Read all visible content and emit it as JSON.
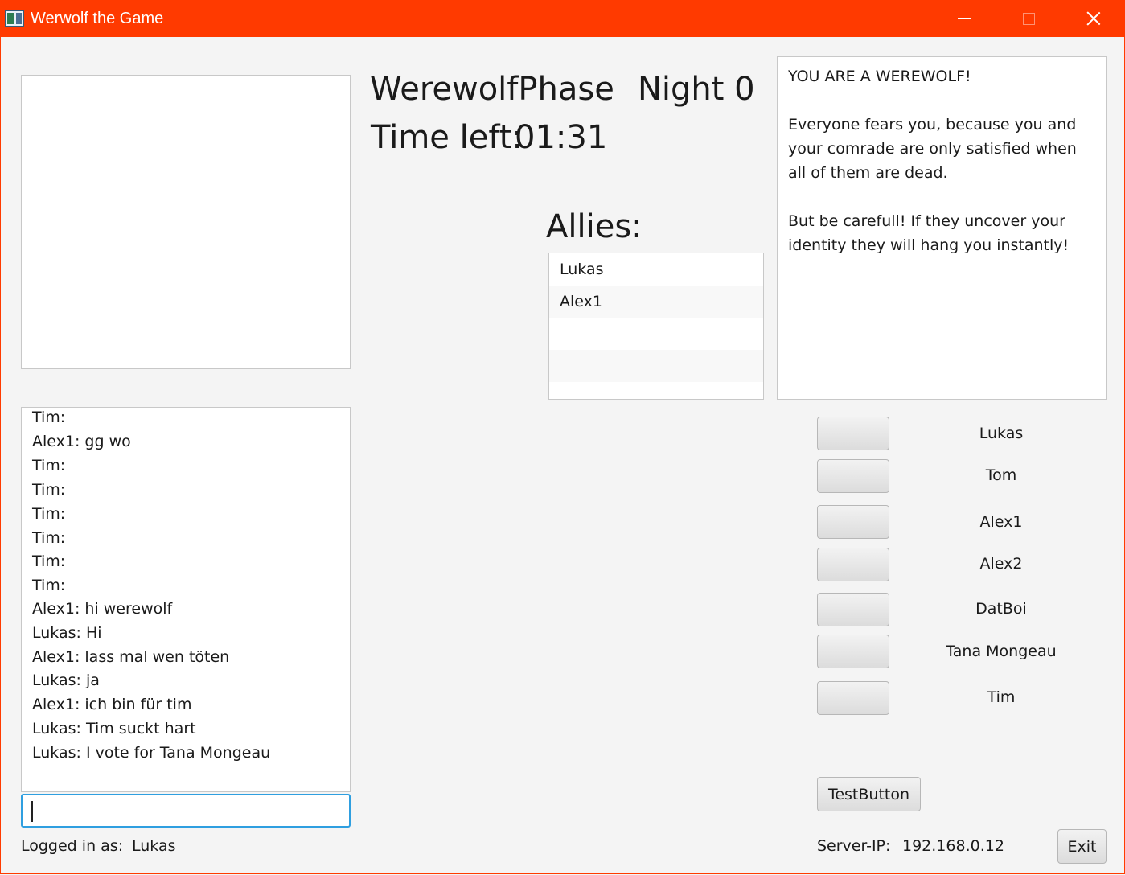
{
  "window": {
    "title": "Werwolf the Game"
  },
  "phase": {
    "name": "WerewolfPhase",
    "night": "Night 0",
    "time_label": "Time left:",
    "time_value": "01:31"
  },
  "allies": {
    "label": "Allies:",
    "items": [
      "Lukas",
      "Alex1"
    ]
  },
  "role": {
    "paragraphs": [
      "YOU ARE A WEREWOLF!",
      "Everyone fears you, because you and your comrade are only satisfied when all of them are dead.",
      "But be carefull! If they uncover your identity they will hang you instantly!"
    ]
  },
  "chat": {
    "messages": [
      "Tim:",
      "Alex1: gg wo",
      "Tim:",
      "Tim:",
      "Tim:",
      "Tim:",
      "Tim:",
      "Tim:",
      "Alex1: hi werewolf",
      "Lukas: Hi",
      "Alex1: lass mal wen töten",
      "Lukas: ja",
      "Alex1: ich bin für tim",
      "Lukas: Tim suckt hart",
      "Lukas: I vote for Tana Mongeau"
    ],
    "input_value": ""
  },
  "players": [
    "Lukas",
    "Tom",
    "Alex1",
    "Alex2",
    "DatBoi",
    "Tana Mongeau",
    "Tim"
  ],
  "footer": {
    "logged_label": "Logged in as:",
    "logged_user": "Lukas",
    "test_button": "TestButton",
    "server_label": "Server-IP:",
    "server_ip": "192.168.0.12",
    "exit_button": "Exit"
  },
  "colors": {
    "titlebar": "#ff3a00",
    "focus": "#2f9fe0"
  }
}
